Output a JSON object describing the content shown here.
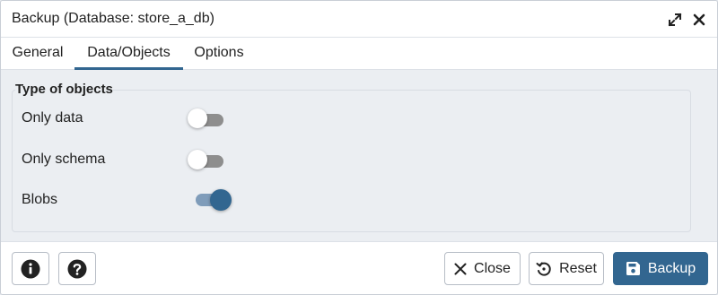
{
  "dialog": {
    "title": "Backup (Database: store_a_db)",
    "icons": {
      "expand": "expand-icon",
      "close": "close-icon"
    }
  },
  "tabs": [
    {
      "label": "General",
      "active": false
    },
    {
      "label": "Data/Objects",
      "active": true
    },
    {
      "label": "Options",
      "active": false
    }
  ],
  "section": {
    "legend": "Type of objects",
    "options": [
      {
        "label": "Only data",
        "enabled": false
      },
      {
        "label": "Only schema",
        "enabled": false
      },
      {
        "label": "Blobs",
        "enabled": true
      }
    ]
  },
  "footer": {
    "info_icon": "info-icon",
    "help_icon": "help-icon",
    "close_label": "Close",
    "reset_label": "Reset",
    "backup_label": "Backup"
  },
  "colors": {
    "accent": "#326690",
    "switch_on_track": "#7f9cba",
    "switch_off_track": "#8e8e8e"
  }
}
